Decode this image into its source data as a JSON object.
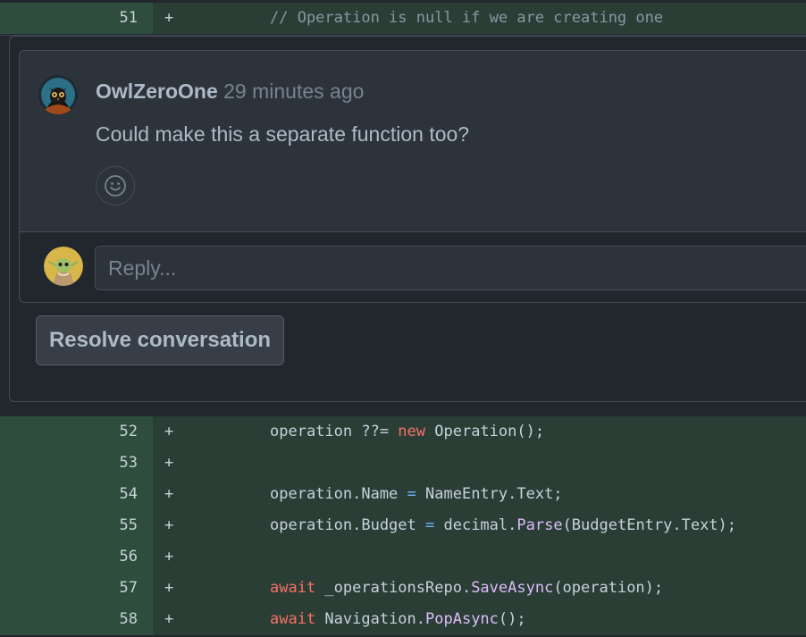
{
  "colors": {
    "background": "#22272e",
    "gutter_added": "#2f4d3d",
    "code_added": "#2b3e35",
    "keyword": "#f47067",
    "function": "#dcbdfb",
    "operator": "#6cb6ff",
    "comment": "#8a96a3"
  },
  "diff_top": {
    "line_number": "51",
    "marker": "+",
    "code": "// Operation is null if we are creating one"
  },
  "thread": {
    "comment": {
      "author": "OwlZeroOne",
      "time": "29 minutes ago",
      "body": "Could make this a separate function too?",
      "avatar_icon": "owl-avatar-icon",
      "reaction_icon": "smiley-icon"
    },
    "reply": {
      "placeholder": "Reply...",
      "avatar_icon": "yoda-avatar-icon"
    },
    "resolve_label": "Resolve conversation"
  },
  "diff_lines": [
    {
      "num": "52",
      "marker": "+",
      "tokens": [
        {
          "t": "operation ??= ",
          "c": ""
        },
        {
          "t": "new",
          "c": "kw"
        },
        {
          "t": " Operation();",
          "c": ""
        }
      ]
    },
    {
      "num": "53",
      "marker": "+",
      "tokens": []
    },
    {
      "num": "54",
      "marker": "+",
      "tokens": [
        {
          "t": "operation.Name ",
          "c": ""
        },
        {
          "t": "=",
          "c": "op"
        },
        {
          "t": " NameEntry.Text;",
          "c": ""
        }
      ]
    },
    {
      "num": "55",
      "marker": "+",
      "tokens": [
        {
          "t": "operation.Budget ",
          "c": ""
        },
        {
          "t": "=",
          "c": "op"
        },
        {
          "t": " decimal.",
          "c": ""
        },
        {
          "t": "Parse",
          "c": "fn"
        },
        {
          "t": "(BudgetEntry.Text);",
          "c": ""
        }
      ]
    },
    {
      "num": "56",
      "marker": "+",
      "tokens": []
    },
    {
      "num": "57",
      "marker": "+",
      "tokens": [
        {
          "t": "await",
          "c": "kw"
        },
        {
          "t": " _operationsRepo.",
          "c": ""
        },
        {
          "t": "SaveAsync",
          "c": "fn"
        },
        {
          "t": "(operation);",
          "c": ""
        }
      ]
    },
    {
      "num": "58",
      "marker": "+",
      "tokens": [
        {
          "t": "await",
          "c": "kw"
        },
        {
          "t": " Navigation.",
          "c": ""
        },
        {
          "t": "PopAsync",
          "c": "fn"
        },
        {
          "t": "();",
          "c": ""
        }
      ]
    }
  ]
}
